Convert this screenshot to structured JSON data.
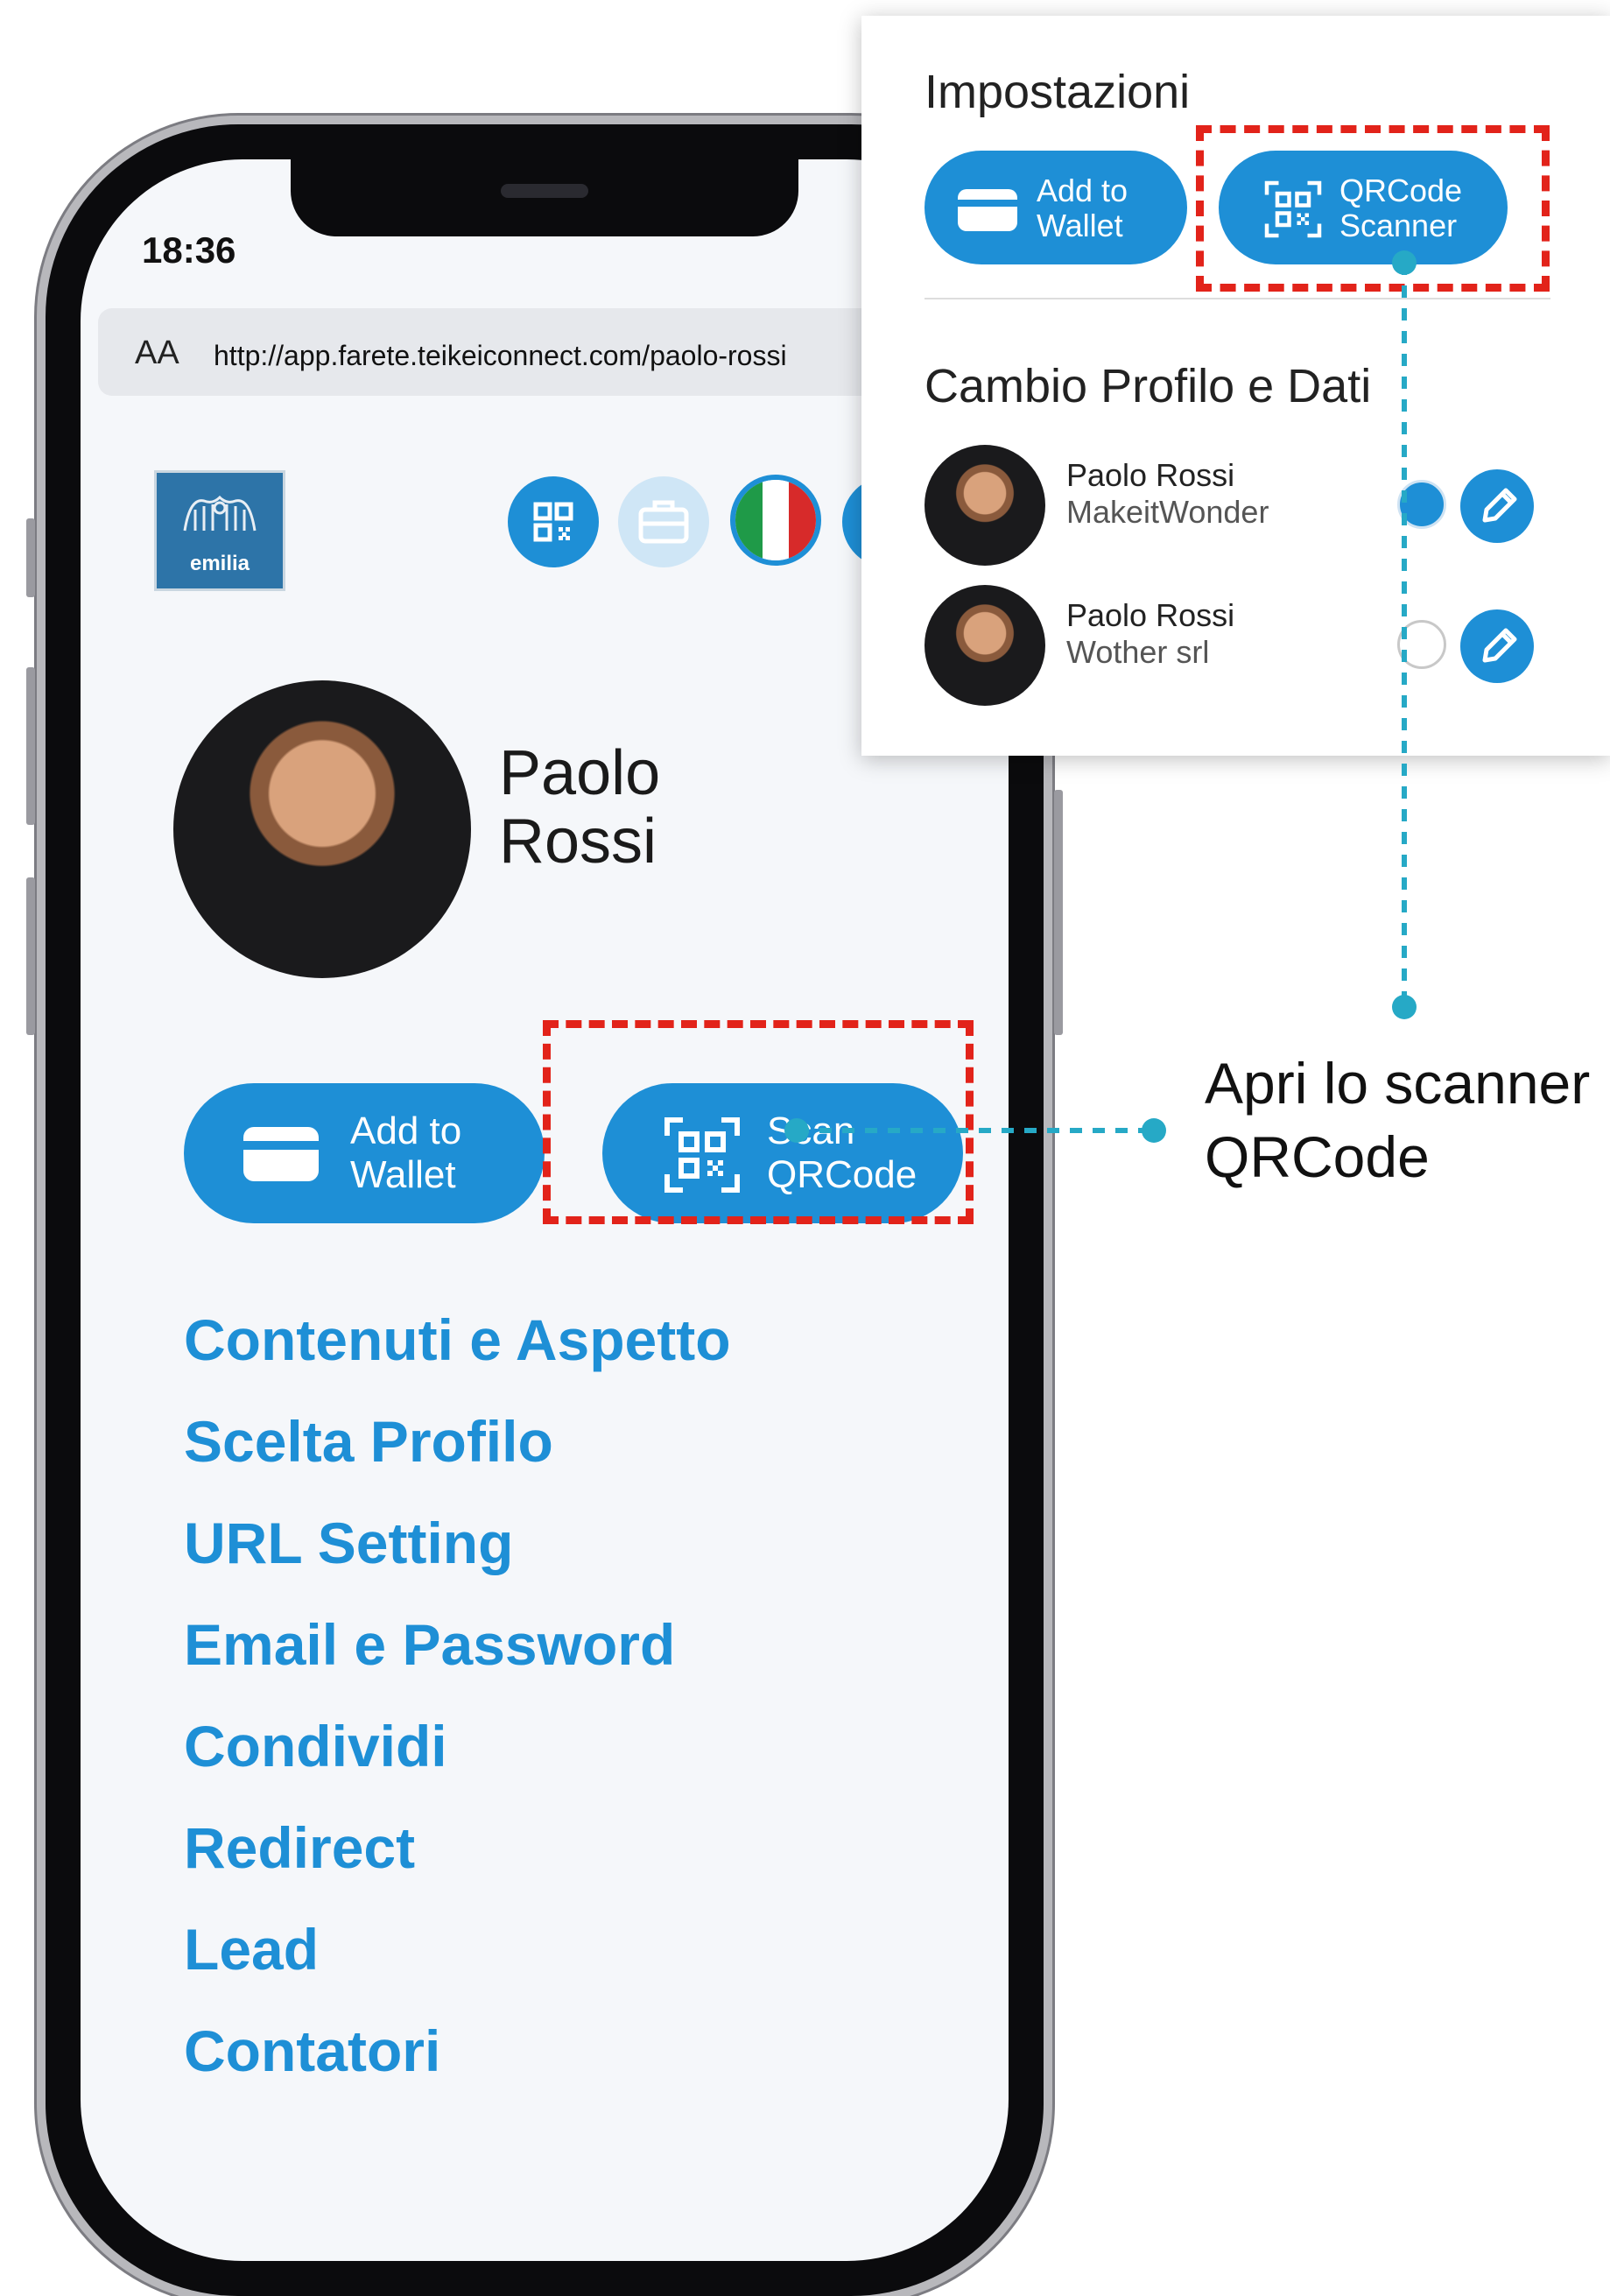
{
  "status_bar": {
    "time": "18:36"
  },
  "browser": {
    "text_size_label": "AA",
    "url": "http://app.farete.teikeiconnect.com/paolo-rossi"
  },
  "logo": {
    "text": "emilia"
  },
  "header_icons": [
    "qr-code-icon",
    "briefcase-icon",
    "italy-flag-icon",
    "more-icon"
  ],
  "profile": {
    "first_name": "Paolo",
    "last_name": "Rossi"
  },
  "actions": {
    "wallet": {
      "label": "Add to\nWallet"
    },
    "scan": {
      "label": "Scan\nQRCode"
    }
  },
  "menu": [
    {
      "label": "Contenuti e Aspetto"
    },
    {
      "label": "Scelta Profilo"
    },
    {
      "label": "URL Setting"
    },
    {
      "label": "Email e Password"
    },
    {
      "label": "Condividi"
    },
    {
      "label": "Redirect"
    },
    {
      "label": "Lead"
    },
    {
      "label": "Contatori"
    }
  ],
  "panel": {
    "title": "Impostazioni",
    "wallet_label": "Add to\nWallet",
    "scanner_label": "QRCode\nScanner",
    "section_title": "Cambio Profilo e Dati",
    "profiles": [
      {
        "name": "Paolo Rossi",
        "company": "MakeitWonder",
        "selected": true
      },
      {
        "name": "Paolo Rossi",
        "company": "Wother srl",
        "selected": false
      }
    ]
  },
  "callout": {
    "text": "Apri lo scanner\nQRCode"
  },
  "colors": {
    "accent": "#1e8fd6",
    "highlight": "#e2231a",
    "connector": "#26a9c6"
  }
}
